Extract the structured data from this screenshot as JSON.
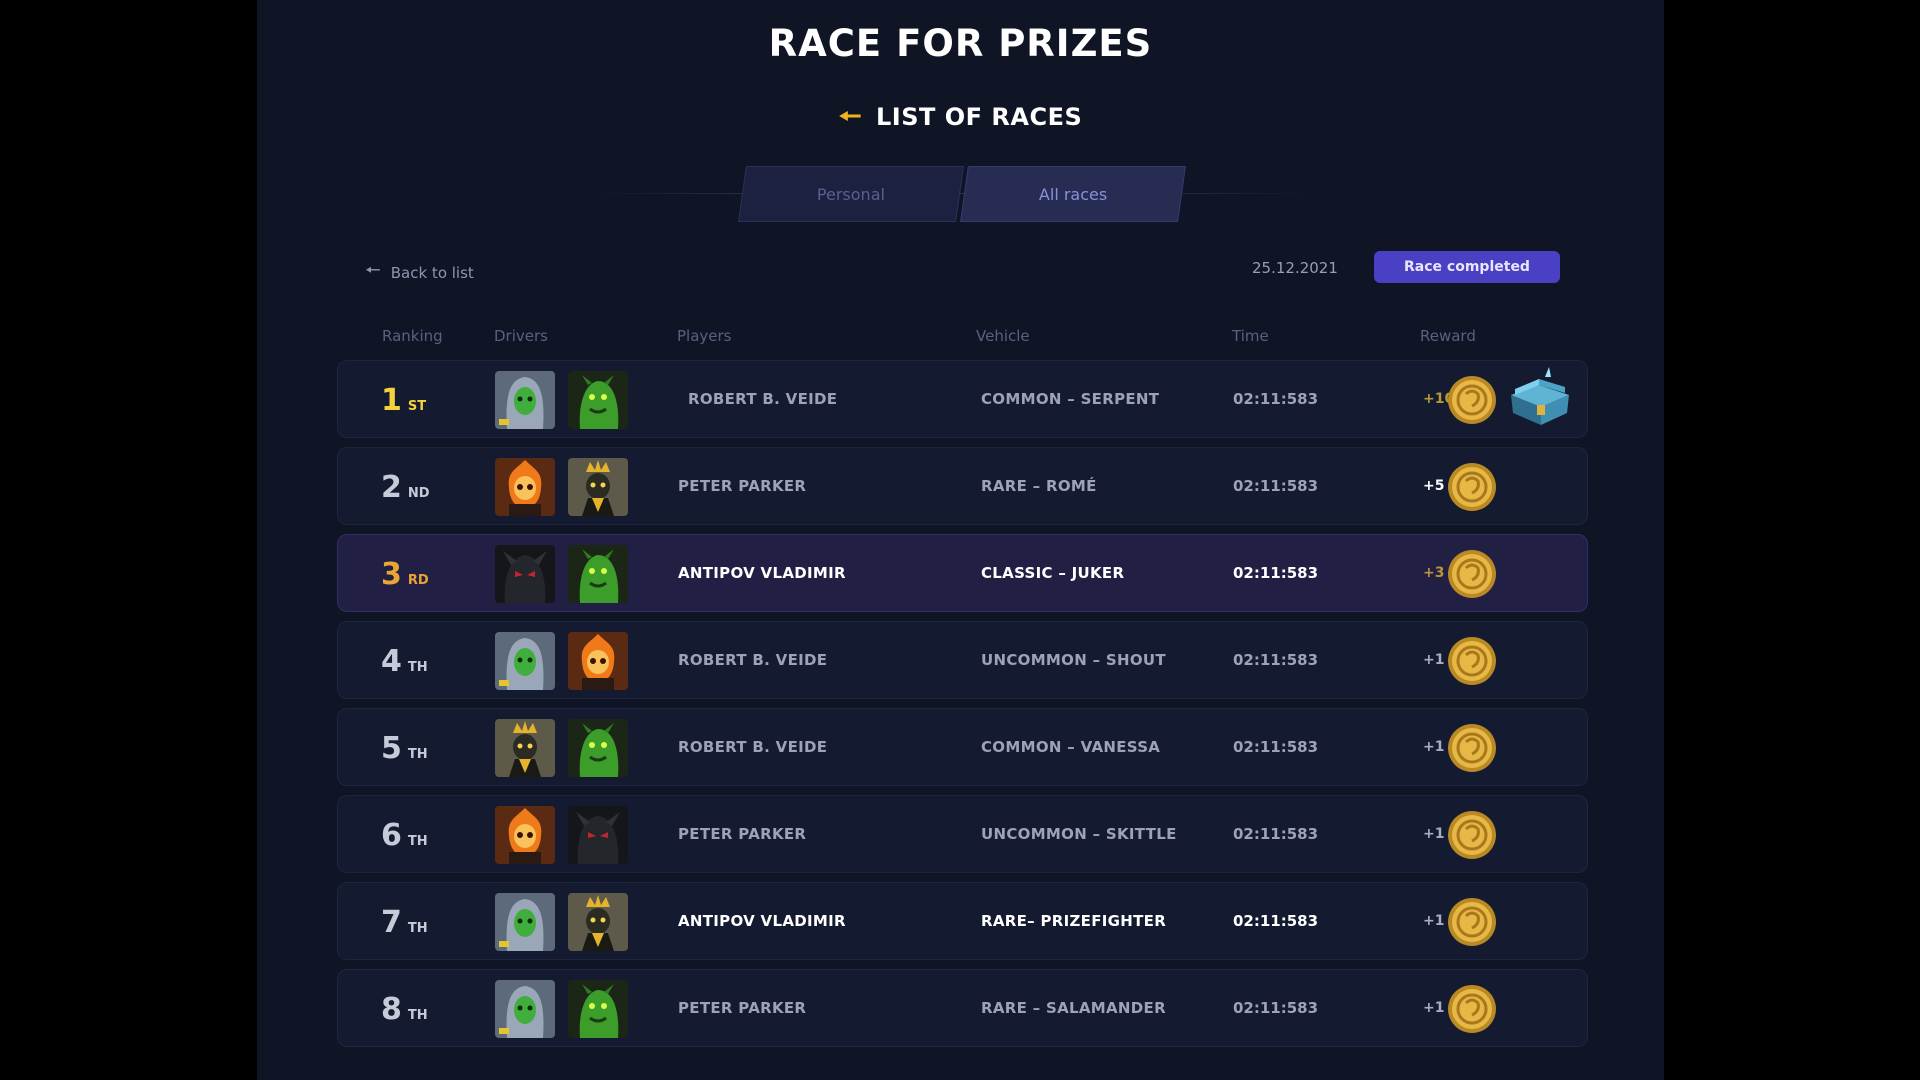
{
  "header": {
    "title": "RACE FOR PRIZES",
    "subtitle": "LIST OF RACES",
    "back_arrow_icon": "arrow-left-icon"
  },
  "tabs": [
    {
      "label": "Personal",
      "active": false
    },
    {
      "label": "All races",
      "active": true
    }
  ],
  "toolbar": {
    "back_label": "Back to list",
    "date": "25.12.2021",
    "status": "Race completed"
  },
  "columns": [
    "Ranking",
    "Drivers",
    "Players",
    "Vehicle",
    "Time",
    "Reward"
  ],
  "rows": [
    {
      "rank": "1",
      "suffix": "ST",
      "drivers": [
        "hooded-green-driver",
        "green-beast-driver"
      ],
      "player": "ROBERT B. VEIDE",
      "vehicle": "COMMON – SERPENT",
      "time": "02:11:583",
      "reward": "+10",
      "chest": true
    },
    {
      "rank": "2",
      "suffix": "ND",
      "drivers": [
        "flame-skull-driver",
        "gold-crown-driver"
      ],
      "player": "PETER PARKER",
      "vehicle": "RARE – ROMÉ",
      "time": "02:11:583",
      "reward": "+5"
    },
    {
      "rank": "3",
      "suffix": "RD",
      "drivers": [
        "dark-beast-driver",
        "green-beast-driver"
      ],
      "player": "ANTIPOV VLADIMIR",
      "vehicle": "CLASSIC – JUKER",
      "time": "02:11:583",
      "reward": "+3",
      "highlight": true
    },
    {
      "rank": "4",
      "suffix": "TH",
      "drivers": [
        "hooded-green-driver",
        "flame-skull-driver"
      ],
      "player": "ROBERT B. VEIDE",
      "vehicle": "UNCOMMON – SHOUT",
      "time": "02:11:583",
      "reward": "+1"
    },
    {
      "rank": "5",
      "suffix": "TH",
      "drivers": [
        "gold-crown-driver",
        "green-beast-driver"
      ],
      "player": "ROBERT B. VEIDE",
      "vehicle": "COMMON – VANESSA",
      "time": "02:11:583",
      "reward": "+1"
    },
    {
      "rank": "6",
      "suffix": "TH",
      "drivers": [
        "flame-skull-driver",
        "dark-beast-driver"
      ],
      "player": "PETER PARKER",
      "vehicle": "UNCOMMON – SKITTLE",
      "time": "02:11:583",
      "reward": "+1"
    },
    {
      "rank": "7",
      "suffix": "TH",
      "drivers": [
        "hooded-green-driver",
        "gold-crown-driver"
      ],
      "player": "ANTIPOV VLADIMIR",
      "vehicle": "RARE– PRIZEFIGHTER",
      "time": "02:11:583",
      "reward": "+1",
      "bold": true
    },
    {
      "rank": "8",
      "suffix": "TH",
      "drivers": [
        "hooded-green-driver",
        "green-beast-driver"
      ],
      "player": "PETER PARKER",
      "vehicle": "RARE – SALAMANDER",
      "time": "02:11:583",
      "reward": "+1"
    }
  ],
  "colors": {
    "background": "#0f1524",
    "gold": "#f0b21f",
    "status_badge": "#4a40c4",
    "highlight_row": "#211f44"
  }
}
